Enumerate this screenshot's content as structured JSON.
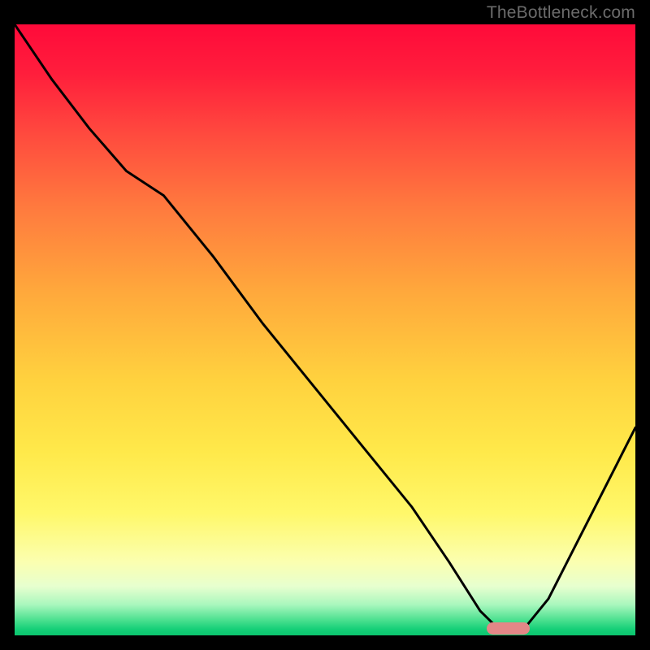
{
  "watermark": "TheBottleneck.com",
  "colors": {
    "frame": "#000000",
    "curve": "#000000",
    "marker": "#e38787"
  },
  "chart_data": {
    "type": "line",
    "title": "",
    "xlabel": "",
    "ylabel": "",
    "xlim": [
      0,
      100
    ],
    "ylim": [
      0,
      100
    ],
    "grid": false,
    "legend": false,
    "series": [
      {
        "name": "bottleneck-curve",
        "x": [
          0,
          6,
          12,
          18,
          24,
          32,
          40,
          48,
          56,
          64,
          70,
          75,
          78,
          82,
          86,
          90,
          94,
          100
        ],
        "values": [
          100,
          91,
          83,
          76,
          72,
          62,
          51,
          41,
          31,
          21,
          12,
          4,
          1,
          1,
          6,
          14,
          22,
          34
        ]
      }
    ],
    "marker": {
      "x_start": 76,
      "x_end": 83,
      "y": 1
    },
    "background_gradient_note": "vertical red→green heat gradient; y encodes bottleneck severity (100=worst, 0=best)"
  }
}
